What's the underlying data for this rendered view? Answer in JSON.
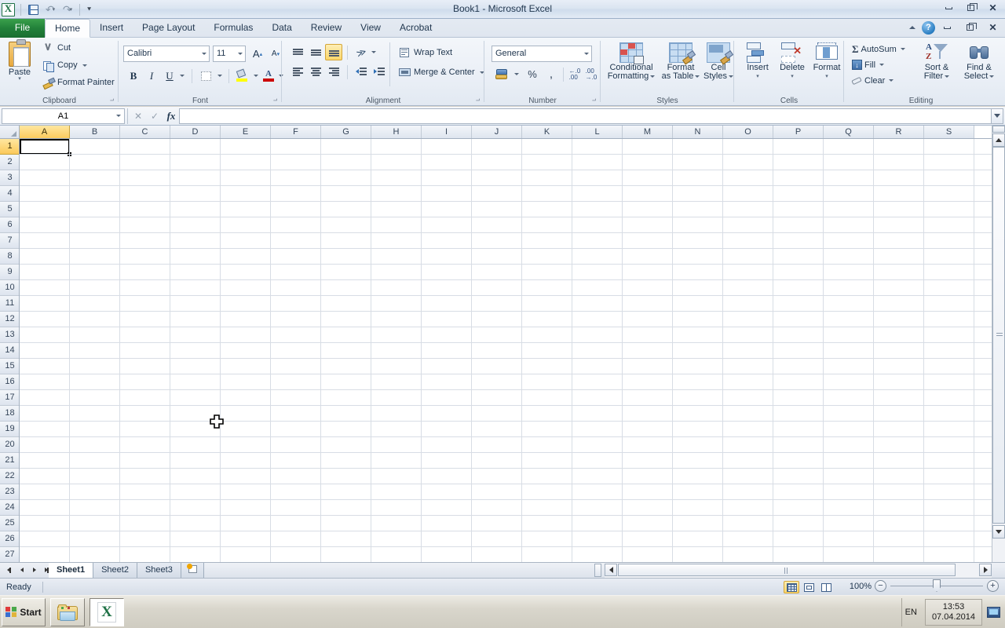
{
  "window": {
    "title": "Book1 - Microsoft Excel",
    "minimize": "Minimize",
    "restore": "Restore Down",
    "close": "Close"
  },
  "quick_access": {
    "app_icon": "excel-logo-icon",
    "save": "Save",
    "undo": "Undo",
    "redo": "Redo",
    "customize": "Customize Quick Access Toolbar"
  },
  "ribbon_tabs": [
    {
      "label": "File",
      "active": false,
      "file": true
    },
    {
      "label": "Home",
      "active": true
    },
    {
      "label": "Insert",
      "active": false
    },
    {
      "label": "Page Layout",
      "active": false
    },
    {
      "label": "Formulas",
      "active": false
    },
    {
      "label": "Data",
      "active": false
    },
    {
      "label": "Review",
      "active": false
    },
    {
      "label": "View",
      "active": false
    },
    {
      "label": "Acrobat",
      "active": false
    }
  ],
  "ribbon_right": {
    "help": "?",
    "minimize_ribbon": "Minimize the Ribbon"
  },
  "groups": {
    "clipboard": {
      "label": "Clipboard",
      "paste": "Paste",
      "cut": "Cut",
      "copy": "Copy",
      "format_painter": "Format Painter"
    },
    "font": {
      "label": "Font",
      "font_name": "Calibri",
      "font_size": "11",
      "grow_font": "A",
      "shrink_font": "A",
      "bold": "B",
      "italic": "I",
      "underline": "U",
      "borders": "Borders",
      "fill_color": "Fill Color",
      "font_color": "Font Color"
    },
    "alignment": {
      "label": "Alignment",
      "top_align": "Top Align",
      "middle_align": "Middle Align",
      "bottom_align": "Bottom Align",
      "orientation": "Orientation",
      "align_left": "Align Text Left",
      "center": "Center",
      "align_right": "Align Text Right",
      "decrease_indent": "Decrease Indent",
      "increase_indent": "Increase Indent",
      "wrap_text": "Wrap Text",
      "merge_center": "Merge & Center"
    },
    "number": {
      "label": "Number",
      "format": "General",
      "accounting": "Accounting Number Format",
      "percent": "%",
      "comma": ",",
      "increase_decimal": "Increase Decimal",
      "decrease_decimal": "Decrease Decimal"
    },
    "styles": {
      "label": "Styles",
      "conditional_formatting_l1": "Conditional",
      "conditional_formatting_l2": "Formatting",
      "format_as_table_l1": "Format",
      "format_as_table_l2": "as Table",
      "cell_styles_l1": "Cell",
      "cell_styles_l2": "Styles"
    },
    "cells": {
      "label": "Cells",
      "insert": "Insert",
      "delete": "Delete",
      "format": "Format"
    },
    "editing": {
      "label": "Editing",
      "autosum": "AutoSum",
      "fill": "Fill",
      "clear": "Clear",
      "sort_filter_l1": "Sort &",
      "sort_filter_l2": "Filter",
      "find_select_l1": "Find &",
      "find_select_l2": "Select"
    }
  },
  "formula_bar": {
    "name_box": "A1",
    "cancel": "Cancel",
    "enter": "Enter",
    "insert_function": "fx",
    "value": "",
    "expand": "Expand Formula Bar"
  },
  "grid": {
    "columns": [
      "A",
      "B",
      "C",
      "D",
      "E",
      "F",
      "G",
      "H",
      "I",
      "J",
      "K",
      "L",
      "M",
      "N",
      "O",
      "P",
      "Q",
      "R",
      "S"
    ],
    "rows": [
      1,
      2,
      3,
      4,
      5,
      6,
      7,
      8,
      9,
      10,
      11,
      12,
      13,
      14,
      15,
      16,
      17,
      18,
      19,
      20,
      21,
      22,
      23,
      24,
      25,
      26,
      27
    ],
    "selected_cell": "A1",
    "selected_column": "A",
    "selected_row": 1,
    "select_all": "Select All"
  },
  "sheet_tabs": {
    "first": "First Sheet",
    "prev": "Previous Sheet",
    "next": "Next Sheet",
    "last": "Last Sheet",
    "sheets": [
      {
        "label": "Sheet1",
        "active": true
      },
      {
        "label": "Sheet2",
        "active": false
      },
      {
        "label": "Sheet3",
        "active": false
      }
    ],
    "insert_worksheet": "Insert Worksheet"
  },
  "status_bar": {
    "mode": "Ready",
    "view_normal": "Normal",
    "view_page_layout": "Page Layout",
    "view_page_break": "Page Break Preview",
    "zoom": "100%",
    "zoom_out": "−",
    "zoom_in": "+"
  },
  "taskbar": {
    "start": "Start",
    "items": [
      {
        "name": "explorer",
        "active": false
      },
      {
        "name": "excel",
        "active": true
      }
    ],
    "language": "EN",
    "time": "13:53",
    "date": "07.04.2014",
    "network": "network-icon"
  },
  "colors": {
    "file_tab_green": "#1e7145",
    "selection_yellow": "#fbc95a",
    "title_text": "#21374f",
    "ribbon_bg": "#eaeff6"
  }
}
